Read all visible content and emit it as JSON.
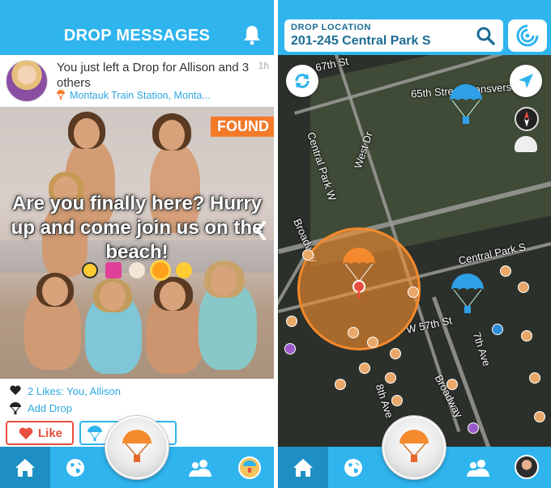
{
  "left": {
    "header": {
      "title": "DROP MESSAGES",
      "bell_icon": "bell-icon"
    },
    "post": {
      "message": "You just left a Drop for Allison and 3 others",
      "time": "1h",
      "location": "Montauk Train Station, Monta...",
      "location_icon": "parachute-pin-icon",
      "badge": "FOUND",
      "overlay_text": "Are you finally here? Hurry up and come join us on the beach!",
      "emojis": [
        "sunglasses-emoji",
        "bikini-emoji",
        "shell-emoji",
        "sun-emoji",
        "grin-emoji"
      ]
    },
    "likes": {
      "label": "2 Likes: You, Allison"
    },
    "add_drop": {
      "label": "Add Drop"
    },
    "actions": {
      "like_label": "Like",
      "drop_icon": "parachute-icon"
    },
    "nav": {
      "items": [
        "home-icon",
        "globe-icon",
        "drop-center-icon",
        "friends-icon",
        "profile-drop-icon"
      ],
      "active": "home-icon"
    }
  },
  "right": {
    "header": {
      "location_label": "DROP LOCATION",
      "location_value": "201-245 Central Park S",
      "search_icon": "search-icon",
      "radar_icon": "radar-icon"
    },
    "map": {
      "labels": [
        "67th St",
        "65th Street Transverse",
        "Central Park W",
        "West Dr",
        "Central Park S",
        "Broadway",
        "W 57th St",
        "7th Ave",
        "8th Ave",
        "Broadway"
      ],
      "refresh_icon": "refresh-icon",
      "navigate_icon": "navigate-arrow-icon",
      "compass_icon": "compass-icon"
    },
    "nav": {
      "items": [
        "home-icon",
        "globe-icon",
        "drop-center-icon",
        "friends-icon",
        "avatar"
      ],
      "active": "home-icon"
    }
  },
  "colors": {
    "brand_blue": "#2fb4ee",
    "nav_active": "#1d8fc4",
    "drop_orange": "#f48a2d",
    "like_red": "#e94f3f",
    "link_blue": "#2fa8e0"
  }
}
